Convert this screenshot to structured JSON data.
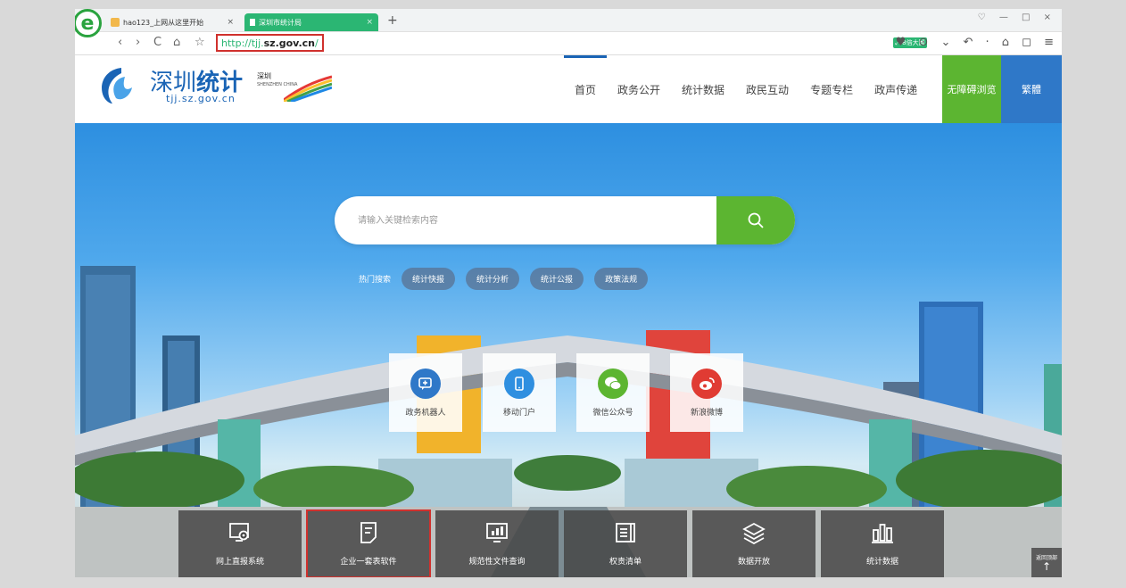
{
  "browser": {
    "tabs": [
      {
        "title": "hao123_上网从这里开始",
        "close": "×"
      },
      {
        "title": "深圳市统计局",
        "close": "×"
      }
    ],
    "new_tab": "+",
    "window_controls": "♡ — □ ×",
    "nav": {
      "back": "‹",
      "forward": "›",
      "reload": "C",
      "home": "⌂",
      "star": "☆"
    },
    "url": {
      "prefix": "http://tjj.",
      "host": "sz.gov.cn",
      "suffix": "/"
    },
    "ext_badge": "⤢ 8倍大圖",
    "tools": "♥ ⊙ ⌄ ↶ · ⌂ ◻ ≡"
  },
  "site": {
    "logo_text_a": "深圳",
    "logo_text_b": "统计",
    "logo_sub": "tjj.sz.gov.cn",
    "partner_logo_title": "深圳",
    "partner_logo_sub": "SHENZHEN CHINA",
    "nav": [
      "首页",
      "政务公开",
      "统计数据",
      "政民互动",
      "专题专栏",
      "政声传递"
    ],
    "btn_access": "无障碍浏览",
    "btn_traditional": "繁體"
  },
  "search": {
    "placeholder": "请输入关键检索内容"
  },
  "hot": {
    "label": "热门搜索",
    "tags": [
      "统计快报",
      "统计分析",
      "统计公报",
      "政策法规"
    ]
  },
  "apps": [
    {
      "label": "政务机器人",
      "color": "#2f78c8",
      "icon": "robot-chat-icon"
    },
    {
      "label": "移动门户",
      "color": "#2f8fe0",
      "icon": "mobile-icon"
    },
    {
      "label": "微信公众号",
      "color": "#5cb531",
      "icon": "wechat-icon"
    },
    {
      "label": "新浪微博",
      "color": "#e03b33",
      "icon": "weibo-icon"
    }
  ],
  "bottom": [
    {
      "label": "网上直报系统",
      "icon": "report-gear-icon"
    },
    {
      "label": "企业一套表软件",
      "icon": "document-icon"
    },
    {
      "label": "规范性文件查询",
      "icon": "chart-screen-icon"
    },
    {
      "label": "权责清单",
      "icon": "list-icon"
    },
    {
      "label": "数据开放",
      "icon": "layers-icon"
    },
    {
      "label": "统计数据",
      "icon": "bar-chart-icon"
    }
  ],
  "back_top": {
    "label": "返回顶部",
    "arrow": "↑"
  }
}
